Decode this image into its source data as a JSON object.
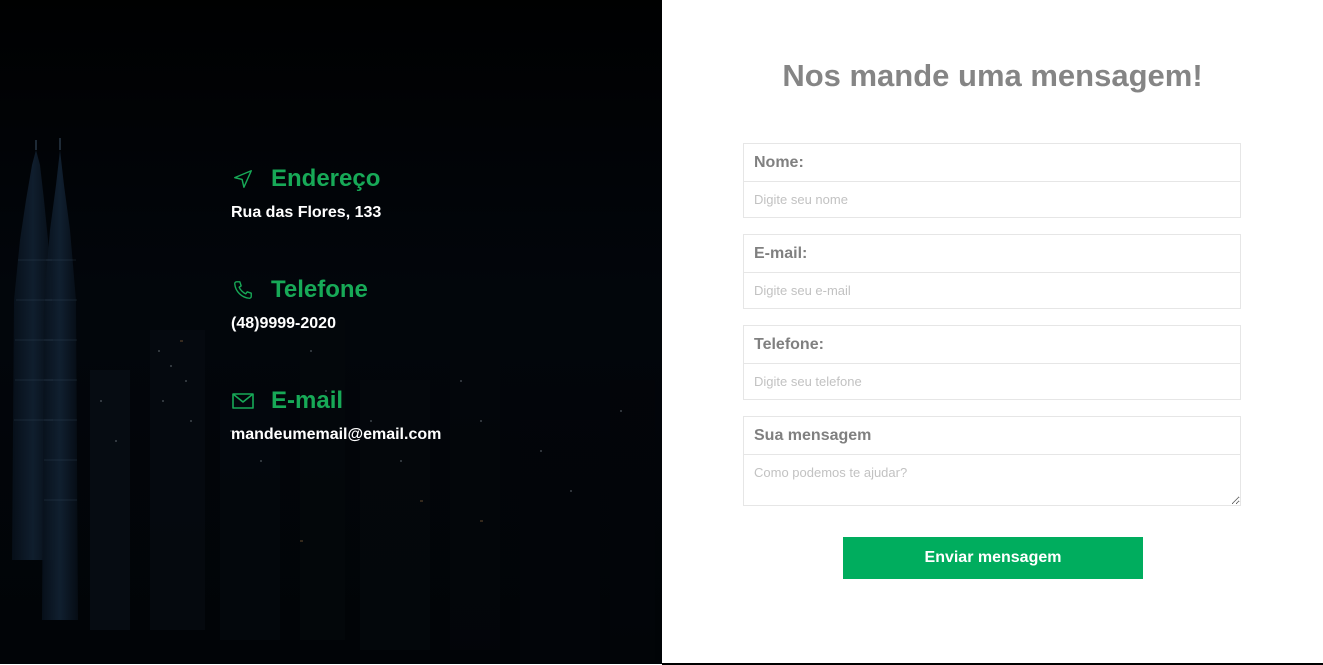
{
  "contacts": [
    {
      "icon": "navigation-arrow-icon",
      "title": "Endereço",
      "value": "Rua das Flores, 133"
    },
    {
      "icon": "phone-icon",
      "title": "Telefone",
      "value": "(48)9999-2020"
    },
    {
      "icon": "mail-icon",
      "title": "E-mail",
      "value": "mandeumemail@email.com"
    }
  ],
  "form": {
    "title": "Nos mande uma mensagem!",
    "name": {
      "label": "Nome:",
      "placeholder": "Digite seu nome",
      "value": ""
    },
    "email": {
      "label": "E-mail:",
      "placeholder": "Digite seu e-mail",
      "value": ""
    },
    "phone": {
      "label": "Telefone:",
      "placeholder": "Digite seu telefone",
      "value": ""
    },
    "message": {
      "label": "Sua mensagem",
      "placeholder": "Como podemos te ajudar?",
      "value": ""
    },
    "submit_label": "Enviar mensagem"
  },
  "colors": {
    "accent": "#00ad5e",
    "accent_text": "#17a957",
    "left_bg": "#020406",
    "title_gray": "#858585"
  }
}
